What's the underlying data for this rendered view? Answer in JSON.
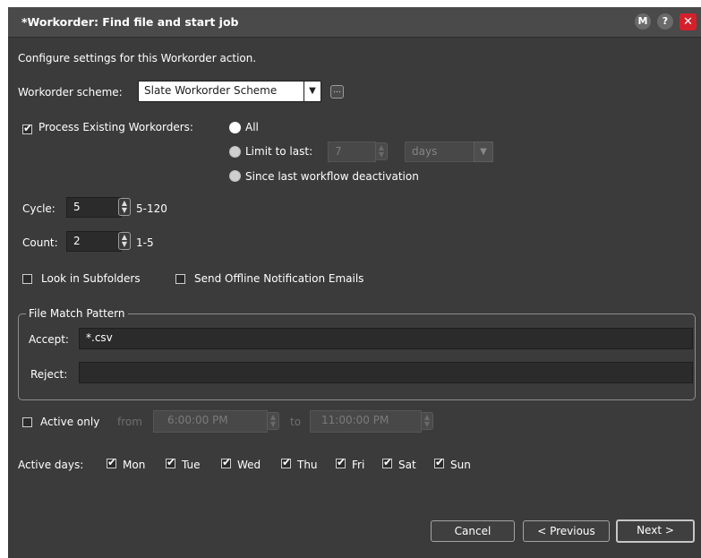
{
  "window": {
    "title": "*Workorder: Find file and start job",
    "buttons": {
      "m": "M",
      "help": "?",
      "close": "✕"
    }
  },
  "intro": "Configure settings for this Workorder action.",
  "scheme": {
    "label": "Workorder scheme:",
    "value": "Slate Workorder Scheme",
    "more_button": "..."
  },
  "process_existing": {
    "label": "Process Existing Workorders:",
    "checked": true,
    "options": {
      "all": "All",
      "limit": "Limit to last:",
      "since": "Since last workflow deactivation"
    },
    "selected": "all",
    "limit_value": "7",
    "limit_unit": "days"
  },
  "cycle": {
    "label": "Cycle:",
    "value": "5",
    "range": "5-120"
  },
  "count": {
    "label": "Count:",
    "value": "2",
    "range": "1-5"
  },
  "look_in_subfolders": {
    "label": "Look in Subfolders",
    "checked": false
  },
  "send_offline": {
    "label": "Send Offline Notification Emails",
    "checked": false
  },
  "file_match": {
    "title": "File Match Pattern",
    "accept_label": "Accept:",
    "accept_value": "*.csv",
    "reject_label": "Reject:",
    "reject_value": ""
  },
  "active_only": {
    "label": "Active only",
    "checked": false,
    "from_label": "from",
    "from_value": "6:00:00  PM",
    "to_label": "to",
    "to_value": "11:00:00  PM"
  },
  "active_days": {
    "label": "Active days:",
    "days": [
      {
        "name": "Mon",
        "checked": true
      },
      {
        "name": "Tue",
        "checked": true
      },
      {
        "name": "Wed",
        "checked": true
      },
      {
        "name": "Thu",
        "checked": true
      },
      {
        "name": "Fri",
        "checked": true
      },
      {
        "name": "Sat",
        "checked": true
      },
      {
        "name": "Sun",
        "checked": true
      }
    ]
  },
  "footer": {
    "cancel": "Cancel",
    "previous": "< Previous",
    "next": "Next >"
  }
}
